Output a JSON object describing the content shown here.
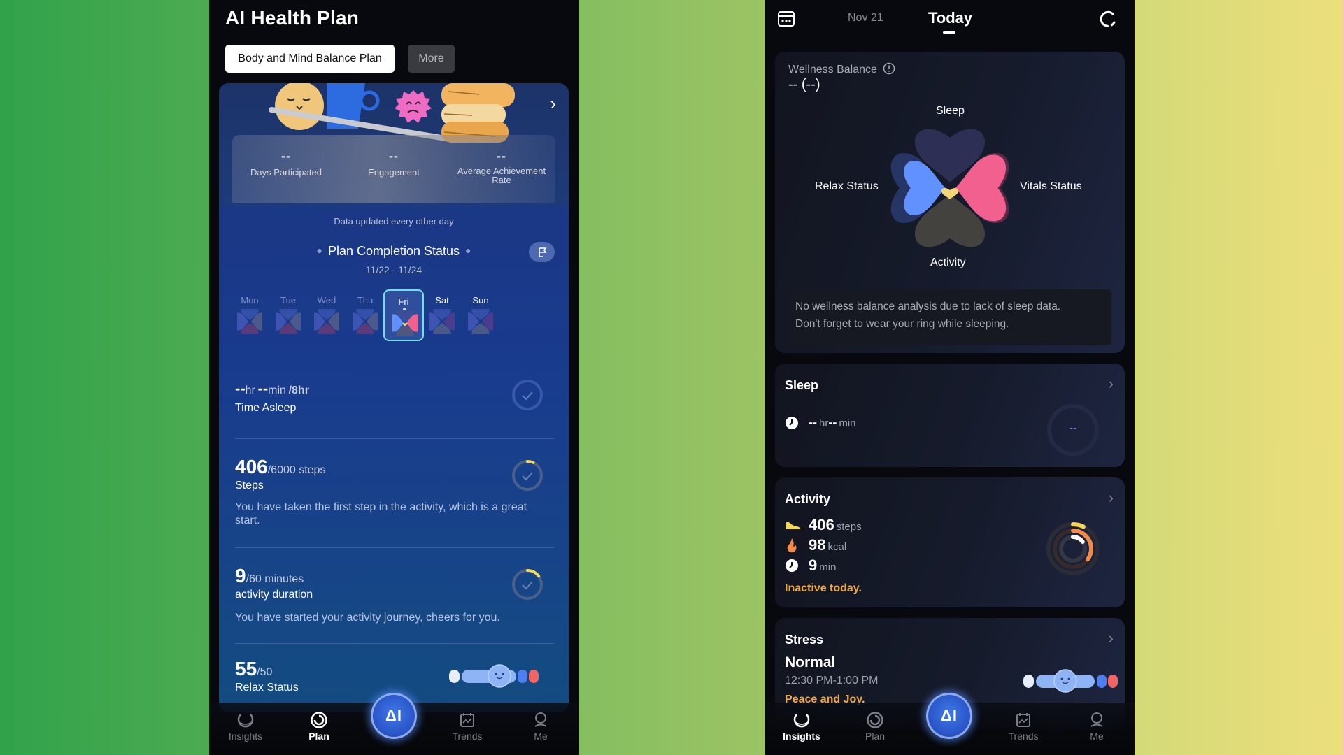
{
  "left": {
    "app_title": "AI Health Plan",
    "tabs": [
      {
        "label": "Body and Mind Balance Plan",
        "active": true
      },
      {
        "label": "More",
        "active": false
      }
    ],
    "stats": [
      {
        "value": "--",
        "label": "Days Participated"
      },
      {
        "value": "--",
        "label": "Engagement"
      },
      {
        "value": "--",
        "label": "Average Achievement Rate"
      }
    ],
    "update_note": "Data updated every other day",
    "completion_title": "Plan Completion Status",
    "date_range": "11/22 - 11/24",
    "days": [
      {
        "label": "Mon",
        "selected": false
      },
      {
        "label": "Tue",
        "selected": false
      },
      {
        "label": "Wed",
        "selected": false
      },
      {
        "label": "Thu",
        "selected": false
      },
      {
        "label": "Fri",
        "selected": true
      },
      {
        "label": "Sat",
        "selected": false
      },
      {
        "label": "Sun",
        "selected": false
      }
    ],
    "metrics": {
      "sleep": {
        "hr": "--",
        "hr_unit": "hr",
        "min": "--",
        "min_unit": "min",
        "goal": "/8hr",
        "label": "Time Asleep",
        "progress": 0
      },
      "steps": {
        "value": "406",
        "goal": "/6000 steps",
        "label": "Steps",
        "desc": "You have taken the first step in the activity, which is a great start.",
        "progress": 0.068
      },
      "duration": {
        "value": "9",
        "goal": "/60 minutes",
        "label": "activity duration",
        "desc": "You have started your activity journey, cheers for you.",
        "progress": 0.15
      },
      "relax": {
        "value": "55",
        "goal": "/50",
        "label": "Relax Status"
      }
    },
    "nav": [
      {
        "label": "Insights",
        "icon": "insights-icon",
        "active": false
      },
      {
        "label": "Plan",
        "icon": "plan-icon",
        "active": true
      },
      {
        "label": "AI",
        "icon": "ai-assistant-icon",
        "active": false
      },
      {
        "label": "Trends",
        "icon": "trends-icon",
        "active": false
      },
      {
        "label": "Me",
        "icon": "profile-icon",
        "active": false
      }
    ]
  },
  "right": {
    "header": {
      "prev_date": "Nov 21",
      "current": "Today"
    },
    "wellness": {
      "title": "Wellness Balance",
      "value": "-- (--)",
      "labels": {
        "top": "Sleep",
        "left": "Relax Status",
        "right": "Vitals Status",
        "bottom": "Activity"
      },
      "notice": [
        "No wellness balance analysis due to lack of sleep data.",
        "Don't forget to wear your ring while sleeping."
      ]
    },
    "sleep": {
      "title": "Sleep",
      "hr": "--",
      "hr_unit": "hr",
      "min": "--",
      "min_unit": "min",
      "score": "--"
    },
    "activity": {
      "title": "Activity",
      "steps": "406",
      "steps_unit": "steps",
      "kcal": "98",
      "kcal_unit": "kcal",
      "minutes": "9",
      "minutes_unit": "min",
      "status": "Inactive today.",
      "rings": {
        "steps": 0.068,
        "kcal": 0.35,
        "minutes": 0.15
      }
    },
    "stress": {
      "title": "Stress",
      "level": "Normal",
      "time": "12:30 PM-1:00 PM",
      "note": "Peace and Joy."
    },
    "nav": [
      {
        "label": "Insights",
        "active": true
      },
      {
        "label": "Plan",
        "active": false
      },
      {
        "label": "AI",
        "active": false
      },
      {
        "label": "Trends",
        "active": false
      },
      {
        "label": "Me",
        "active": false
      }
    ]
  },
  "colors": {
    "accent_yellow": "#f2d65a",
    "accent_orange": "#f2a93b",
    "relax_blue": "#6190ff",
    "vitals_pink": "#f26090",
    "select_border": "#6ee0e8"
  }
}
